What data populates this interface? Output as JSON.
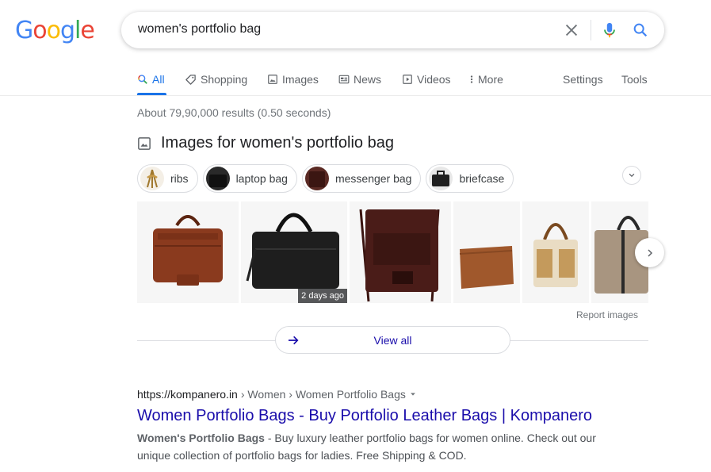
{
  "logo": {
    "letters": [
      "G",
      "o",
      "o",
      "g",
      "l",
      "e"
    ],
    "colors": [
      "#4285f4",
      "#ea4335",
      "#fbbc05",
      "#4285f4",
      "#34a853",
      "#ea4335"
    ]
  },
  "search": {
    "query": "women's portfolio bag"
  },
  "tabs": [
    {
      "label": "All",
      "icon": "search-icon",
      "active": true
    },
    {
      "label": "Shopping",
      "icon": "tag-icon"
    },
    {
      "label": "Images",
      "icon": "image-icon"
    },
    {
      "label": "News",
      "icon": "news-icon"
    },
    {
      "label": "Videos",
      "icon": "video-icon"
    },
    {
      "label": "More",
      "icon": "more-vert-icon"
    }
  ],
  "tools": {
    "settings": "Settings",
    "tools": "Tools"
  },
  "results": {
    "stats": "About 79,90,000 results (0.50 seconds)"
  },
  "images_section": {
    "title": "Images for women's portfolio bag",
    "chips": [
      {
        "label": "ribs"
      },
      {
        "label": "laptop bag"
      },
      {
        "label": "messenger bag"
      },
      {
        "label": "briefcase"
      }
    ],
    "thumbnails": [
      {
        "color": "#8a3a1e"
      },
      {
        "color": "#1e1e1e",
        "badge": "2 days ago"
      },
      {
        "color": "#4a1c18"
      },
      {
        "color": "#a0582c"
      },
      {
        "color": "#e9dcc3"
      },
      {
        "color": "#a89580"
      }
    ],
    "report": "Report images",
    "view_all": "View all"
  },
  "first_result": {
    "domain": "https://kompanero.in",
    "breadcrumb": " › Women › Women Portfolio Bags",
    "title": "Women Portfolio Bags - Buy Portfolio Leather Bags | Kompanero",
    "snippet_bold": "Women's Portfolio Bags",
    "snippet_rest": " - Buy luxury leather portfolio bags for women online. Check out our unique collection of portfolio bags for ladies. Free Shipping & COD."
  }
}
